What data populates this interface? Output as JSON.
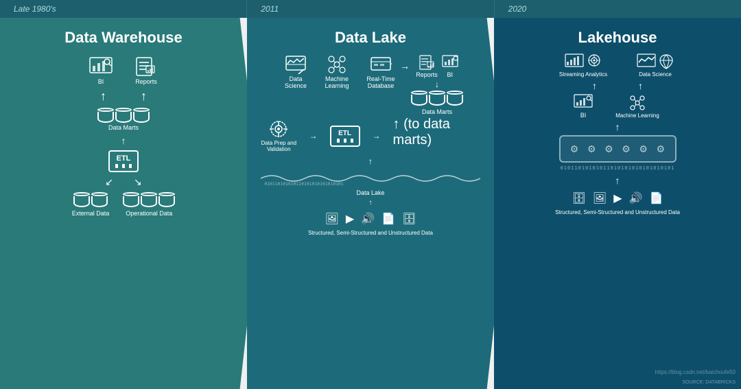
{
  "eras": {
    "warehouse": "Late 1980's",
    "lake": "2011",
    "lakehouse": "2020"
  },
  "titles": {
    "warehouse": "Data Warehouse",
    "lake": "Data Lake",
    "lakehouse": "Lakehouse"
  },
  "warehouse": {
    "bi": "BI",
    "reports": "Reports",
    "data_marts": "Data Marts",
    "etl": "ETL",
    "external_data": "External Data",
    "operational_data": "Operational Data"
  },
  "lake": {
    "data_science": "Data Science",
    "machine_learning": "Machine Learning",
    "realtime_db": "Real-Time Database",
    "reports": "Reports",
    "bi": "BI",
    "data_prep": "Data Prep and Validation",
    "etl": "ETL",
    "data_marts": "Data Marts",
    "data_lake": "Data Lake",
    "sources_label": "Structured, Semi-Structured and Unstructured Data"
  },
  "lakehouse": {
    "streaming": "Streaming Analytics",
    "data_science": "Data Science",
    "bi": "BI",
    "machine_learning": "Machine Learning",
    "sources_label": "Structured, Semi-Structured and Unstructured Data"
  },
  "watermarks": {
    "source": "SOURCE: DATABRICKS",
    "url": "https://blog.csdn.net/baichoufe50"
  },
  "binary": "01011010101011010101010101010101"
}
